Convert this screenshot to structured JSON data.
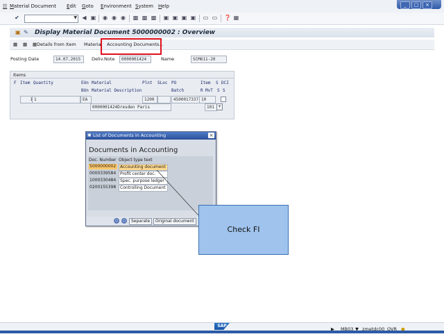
{
  "menu": {
    "items": [
      "Material Document",
      "Edit",
      "Goto",
      "Environment",
      "System",
      "Help"
    ]
  },
  "toolbar": {
    "command_value": ""
  },
  "screen": {
    "title": "Display Material Document 5000000002 : Overview"
  },
  "app_toolbar": {
    "details_label": "Details from Item",
    "material_label": "Material",
    "accounting_label": "Accounting Documents..."
  },
  "header": {
    "posting_date_label": "Posting Date",
    "posting_date_value": "14.07.2015",
    "deliv_note_label": "Deliv.Note",
    "deliv_note_value": "0000001424",
    "name_label": "Name",
    "name_value": "SCM611-20"
  },
  "items": {
    "title": "Items",
    "headers_row1": {
      "f": "F",
      "item": "Item",
      "quantity": "Quantity",
      "eun": "EUn",
      "material": "Material",
      "plnt": "Plnt",
      "sloc": "SLoc",
      "po": "PO",
      "item2": "Item",
      "s": "S",
      "dci": "DCI"
    },
    "headers_row2": {
      "bun": "BUn",
      "matdesc": "Material Description",
      "batch": "Batch",
      "r": "R",
      "mvt": "MvT",
      "s1": "S",
      "s2": "S"
    },
    "row": {
      "item": "1",
      "quantity": "1",
      "eun": "EA",
      "plnt": "1200",
      "po": "4500017337",
      "po_item": "10",
      "matdesc": "0000001424Dresden Paris",
      "mvt": "101"
    }
  },
  "dialog": {
    "window_title": "List of Documents in Accounting",
    "heading": "Documents in Accounting",
    "col_doc": "Doc. Number",
    "col_type": "Object type text",
    "rows": [
      {
        "doc": "5000000002",
        "type": "Accounting document",
        "selected": true
      },
      {
        "doc": "0000339584",
        "type": "Profit center doc.",
        "selected": false
      },
      {
        "doc": "1000330484",
        "type": "Spec. purpose ledger",
        "selected": false
      },
      {
        "doc": "0200155398",
        "type": "Controlling Document",
        "selected": false
      }
    ],
    "btn_separate": "Separate",
    "btn_original": "Original document"
  },
  "callout": {
    "text": "Check FI"
  },
  "status": {
    "tcode": "MB03",
    "server": "zmetdc00",
    "mode": "OVR",
    "logo": "SAP"
  },
  "colors": {
    "highlight": "#e0101c",
    "callout_fill": "#9fc3ec",
    "selection": "#ffc86a"
  }
}
